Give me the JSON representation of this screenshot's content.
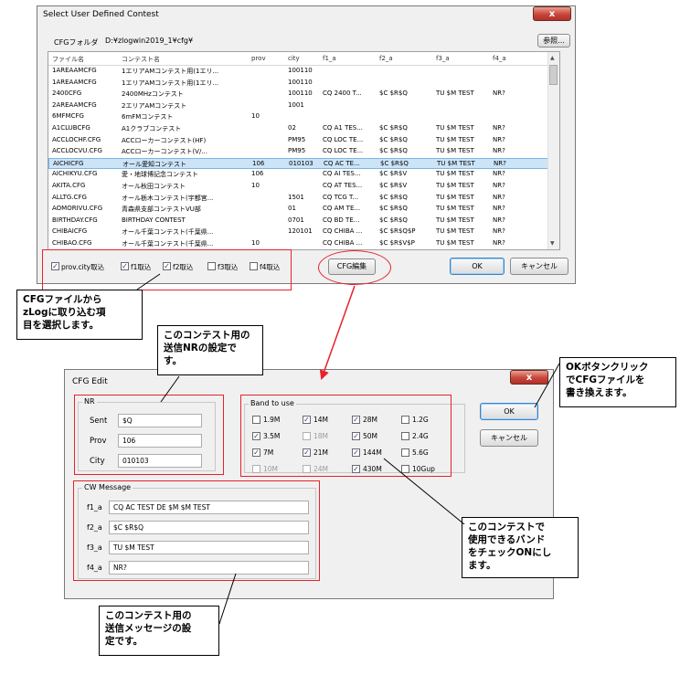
{
  "top_dialog": {
    "title": "Select User Defined Contest",
    "close": "x",
    "folder_label": "CFGフォルダ",
    "folder_path": "D:¥zlogwin2019_1¥cfg¥",
    "browse": "参照...",
    "columns": [
      "ファイル名",
      "コンテスト名",
      "prov",
      "city",
      "f1_a",
      "f2_a",
      "f3_a",
      "f4_a"
    ],
    "rows": [
      [
        "1AREAAMCFG",
        "1エリアAMコンテスト用(1エリ...",
        "",
        "100110",
        "",
        "",
        "",
        ""
      ],
      [
        "1AREAAMCFG",
        "1エリアAMコンテスト用(1エリ...",
        "",
        "100110",
        "",
        "",
        "",
        ""
      ],
      [
        "2400CFG",
        "2400MHzコンテスト",
        "",
        "100110",
        "CQ 2400 T...",
        "$C $R$Q",
        "TU $M TEST",
        "NR?"
      ],
      [
        "2AREAAMCFG",
        "2エリアAMコンテスト",
        "",
        "1001",
        "",
        "",
        "",
        ""
      ],
      [
        "6MFMCFG",
        "6mFMコンテスト",
        "10",
        "",
        "",
        "",
        "",
        ""
      ],
      [
        "A1CLUBCFG",
        "A1クラブコンテスト",
        "",
        "02",
        "CQ A1 TES...",
        "$C $R$Q",
        "TU $M TEST",
        "NR?"
      ],
      [
        "ACCLOCHF.CFG",
        "ACCローカーコンテスト(HF)",
        "",
        "PM95",
        "CQ LOC TE...",
        "$C $R$Q",
        "TU $M TEST",
        "NR?"
      ],
      [
        "ACCLOCVU.CFG",
        "ACCローカーコンテスト(V/...",
        "",
        "PM95",
        "CQ LOC TE...",
        "$C $R$Q",
        "TU $M TEST",
        "NR?"
      ],
      [
        "AICHICFG",
        "オール愛知コンテスト",
        "106",
        "010103",
        "CQ AC TE...",
        "$C $R$Q",
        "TU $M TEST",
        "NR?"
      ],
      [
        "AICHIKYU.CFG",
        "愛・地球博記念コンテスト",
        "106",
        "",
        "CQ AI TES...",
        "$C $R$V",
        "TU $M TEST",
        "NR?"
      ],
      [
        "AKITA.CFG",
        "オール秋田コンテスト",
        "10",
        "",
        "CQ AT TES...",
        "$C $R$V",
        "TU $M TEST",
        "NR?"
      ],
      [
        "ALLTG.CFG",
        "オール栃木コンテスト(宇都宮...",
        "",
        "1501",
        "CQ TCG T...",
        "$C $R$Q",
        "TU $M TEST",
        "NR?"
      ],
      [
        "AOMORIVU.CFG",
        "青森県支部コンテストVU部",
        "",
        "01",
        "CQ AM TE...",
        "$C $R$Q",
        "TU $M TEST",
        "NR?"
      ],
      [
        "BIRTHDAY.CFG",
        "BIRTHDAY CONTEST",
        "",
        "0701",
        "CQ BD TE...",
        "$C $R$Q",
        "TU $M TEST",
        "NR?"
      ],
      [
        "CHIBAICFG",
        "オール千葉コンテスト(千葉県...",
        "",
        "120101",
        "CQ CHIBA ...",
        "$C $R$Q$P",
        "TU $M TEST",
        "NR?"
      ],
      [
        "CHIBAO.CFG",
        "オール千葉コンテスト(千葉県...",
        "10",
        "",
        "CQ CHIBA ...",
        "$C $R$V$P",
        "TU $M TEST",
        "NR?"
      ]
    ],
    "checks": [
      {
        "label": "prov.city取込",
        "checked": true
      },
      {
        "label": "f1取込",
        "checked": true
      },
      {
        "label": "f2取込",
        "checked": true
      },
      {
        "label": "f3取込",
        "checked": false
      },
      {
        "label": "f4取込",
        "checked": false
      }
    ],
    "cfg_edit": "CFG編集",
    "ok": "OK",
    "cancel": "キャンセル"
  },
  "edit_dialog": {
    "title": "CFG Edit",
    "close": "x",
    "nr_title": "NR",
    "nr_fields": [
      {
        "label": "Sent",
        "value": "$Q"
      },
      {
        "label": "Prov",
        "value": "106"
      },
      {
        "label": "City",
        "value": "010103"
      }
    ],
    "band_title": "Band to use",
    "bands": [
      {
        "label": "1.9M",
        "checked": false,
        "enabled": true
      },
      {
        "label": "14M",
        "checked": true,
        "enabled": true
      },
      {
        "label": "28M",
        "checked": true,
        "enabled": true
      },
      {
        "label": "1.2G",
        "checked": false,
        "enabled": true
      },
      {
        "label": "3.5M",
        "checked": true,
        "enabled": true
      },
      {
        "label": "18M",
        "checked": false,
        "enabled": false
      },
      {
        "label": "50M",
        "checked": true,
        "enabled": true
      },
      {
        "label": "2.4G",
        "checked": false,
        "enabled": true
      },
      {
        "label": "7M",
        "checked": true,
        "enabled": true
      },
      {
        "label": "21M",
        "checked": true,
        "enabled": true
      },
      {
        "label": "144M",
        "checked": true,
        "enabled": true
      },
      {
        "label": "5.6G",
        "checked": false,
        "enabled": true
      },
      {
        "label": "10M",
        "checked": false,
        "enabled": false
      },
      {
        "label": "24M",
        "checked": false,
        "enabled": false
      },
      {
        "label": "430M",
        "checked": true,
        "enabled": true
      },
      {
        "label": "10Gup",
        "checked": false,
        "enabled": true
      }
    ],
    "cw_title": "CW Message",
    "cw_fields": [
      {
        "label": "f1_a",
        "value": "CQ AC TEST DE $M $M TEST"
      },
      {
        "label": "f2_a",
        "value": "$C $R$Q"
      },
      {
        "label": "f3_a",
        "value": "TU $M TEST"
      },
      {
        "label": "f4_a",
        "value": "NR?"
      }
    ],
    "ok": "OK",
    "cancel": "キャンセル"
  },
  "callouts": {
    "import_items": "CFGファイルから\nzLogに取り込む項\n目を選択します。",
    "nr_setting": "このコンテスト用の\n送信NRの設定で\nす。",
    "ok_rewrite": "OKボタンクリック\nでCFGファイルを\n書き換えます。",
    "bands": "このコンテストで\n使用できるバンド\nをチェックONにし\nます。",
    "cw_message": "このコンテスト用の\n送信メッセージの設\n定です。"
  },
  "colors": {
    "highlight": "#e8212c",
    "selection": "#cce4f7"
  }
}
